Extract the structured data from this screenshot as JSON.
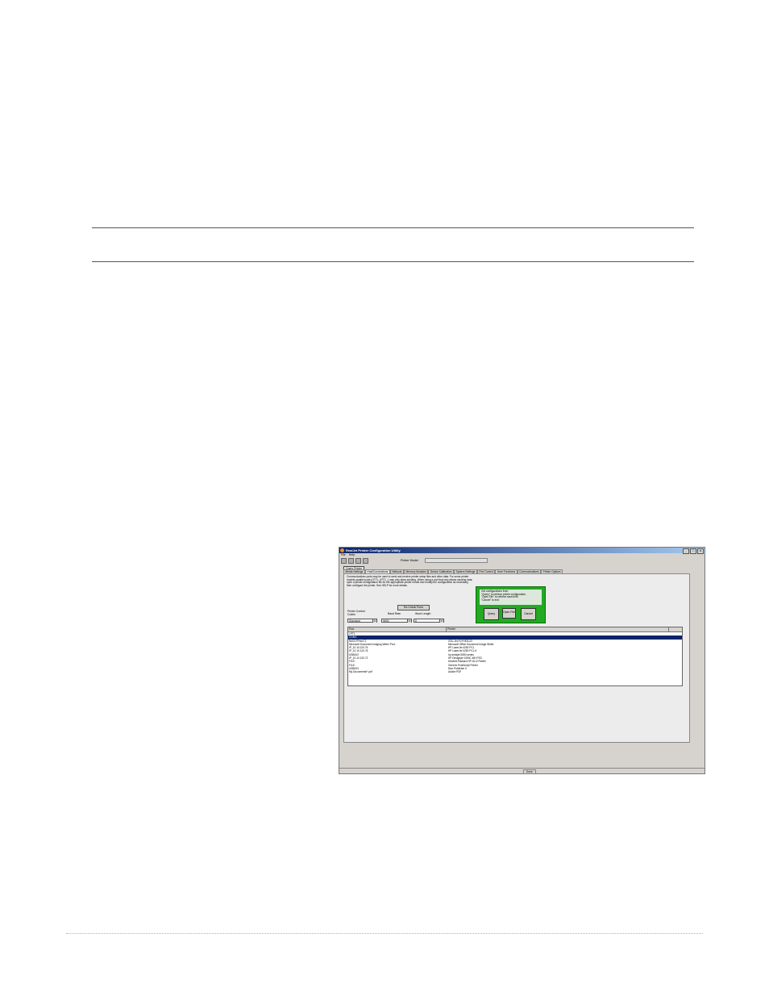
{
  "window": {
    "title": "RealJet Printer Configuration Utility",
    "controls": [
      "_",
      "□",
      "x"
    ],
    "menu": [
      "File",
      "Help"
    ],
    "printer_model_label": "Printer Model:",
    "query_printer_button": "Query Printer",
    "tabs": [
      "Media Settings",
      "Host/Connections",
      "Network",
      "Memory Modules",
      "Device Calibration",
      "System Settings",
      "Port Control",
      "User Functions",
      "Communications",
      "Printer Options"
    ],
    "description": "Communications ports may be used to send and receive printer setup files and other data. For some printer models parallel ports (LPT1, LPT2...) may only allow sending. When using a port that only allows sending data, open a printer configuration file for the appropriate printer model and modify the configuration as necessary, then configure the printer. See HELP for more details.",
    "dialog": {
      "lines": [
        "Get configurations from:",
        "\"Query\" to retrieve printer configuration.",
        "\"Open File\" to retrieve saved file.",
        "\"Cancel\" to exit."
      ],
      "query": "Query",
      "open_file": "Open File",
      "cancel": "Cancel"
    },
    "recheck_button": "Re-Check Ports",
    "printer_control_codes_label": "Printer Control Codes",
    "printer_control_codes_value": "Standard",
    "baud_rate_label": "Baud Rate",
    "baud_rate_value": "9600",
    "word_length_label": "Word Length",
    "word_length_value": "8",
    "list": {
      "headers": [
        "Port",
        "Printer"
      ],
      "rows": [
        {
          "port": "LPT1:",
          "printer": ""
        },
        {
          "port": "COM1:",
          "printer": ""
        },
        {
          "port": "Ne01:FPrint:T1",
          "printer": "GSL-Jet-Fl-FHED120"
        },
        {
          "port": "Microsoft Document Imaging Writer Port:",
          "printer": "Microsoft Office Document Image Writer"
        },
        {
          "port": "IP_10.10.120.76",
          "printer": "HP LaserJet 4250 PCL"
        },
        {
          "port": "IP_10.10.120.76",
          "printer": "HP LaserJet 4250 PCL 6"
        },
        {
          "port": "USB002",
          "printer": "hp deskjet 5550 series"
        },
        {
          "port": "IP_10.10.120.72",
          "printer": "HP Designjet 1050C MH PS3"
        },
        {
          "port": "FILE:",
          "printer": "Hewlett-Packard HP-GL/2 Plotter"
        },
        {
          "port": "FILE:",
          "printer": "Generic PostScript Printer"
        },
        {
          "port": "USB003",
          "printer": "Disc Publisher II"
        },
        {
          "port": "My Documents\\*.pdf",
          "printer": "Adobe PDF"
        }
      ]
    },
    "status": "Done"
  }
}
